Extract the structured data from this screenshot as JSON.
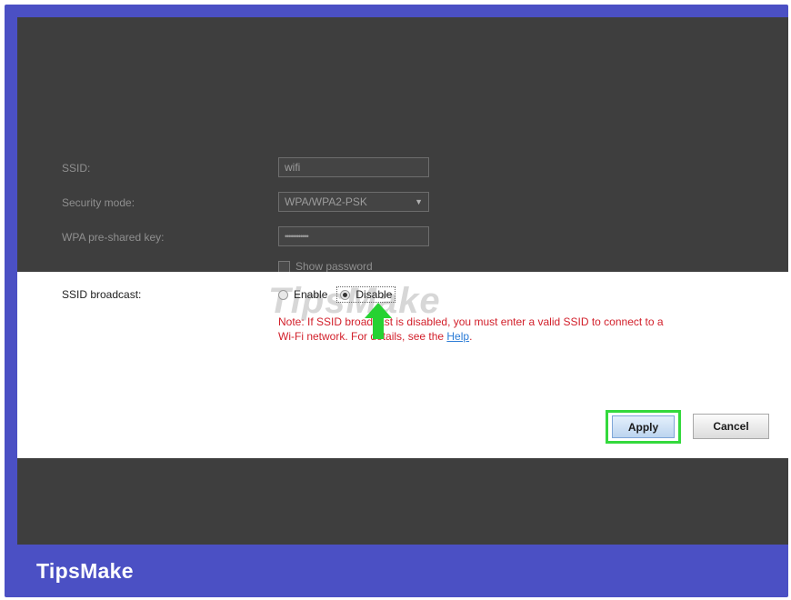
{
  "form": {
    "ssid_label": "SSID:",
    "ssid_value": "wifi",
    "security_label": "Security mode:",
    "security_value": "WPA/WPA2-PSK",
    "psk_label": "WPA pre-shared key:",
    "psk_value": "••••••••••••",
    "show_password_label": "Show password",
    "broadcast_label": "SSID broadcast:",
    "enable_label": "Enable",
    "disable_label": "Disable",
    "broadcast_selected": "Disable",
    "note_text": "Note: If SSID broadcast is disabled, you must enter a valid SSID to connect to a Wi-Fi network. For details, see the ",
    "help_link": "Help",
    "note_end": "."
  },
  "buttons": {
    "apply": "Apply",
    "cancel": "Cancel"
  },
  "watermark": "TipsMake",
  "brand": "TipsMake",
  "colors": {
    "frame": "#4b50c4",
    "highlight": "#34d93d",
    "note": "#d21f2a",
    "link": "#2a7bd6"
  },
  "icons": {
    "dropdown": "chevron-down-icon",
    "pointer": "green-arrow-up-icon"
  }
}
